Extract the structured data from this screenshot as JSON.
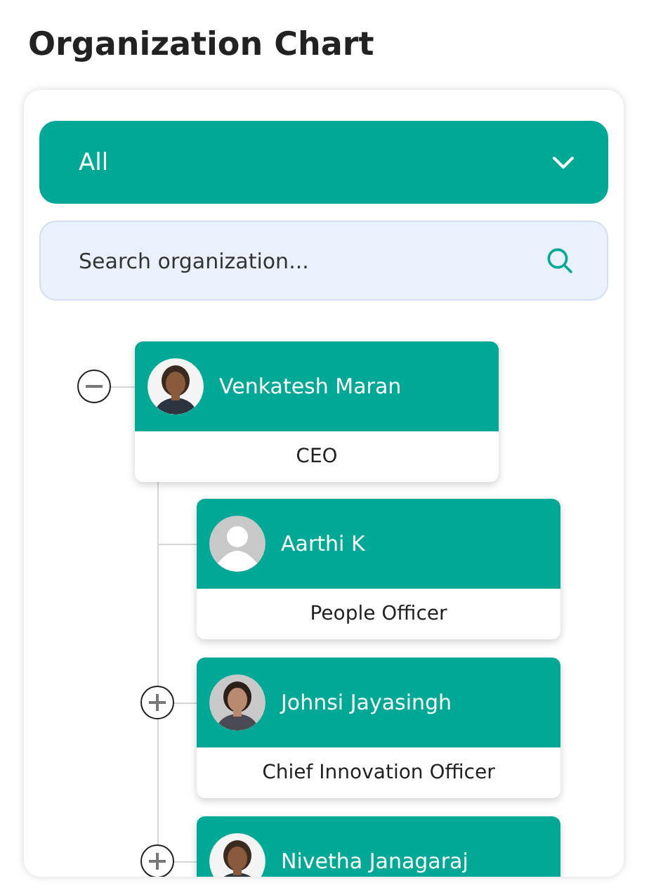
{
  "page": {
    "title": "Organization Chart"
  },
  "filter": {
    "value": "All"
  },
  "search": {
    "placeholder": "Search organization..."
  },
  "org_chart": {
    "nodes": [
      {
        "name": "Venkatesh Maran",
        "role": "CEO",
        "expanded": true,
        "children": [
          {
            "name": "Aarthi K",
            "role": "People Officer",
            "avatar": {
              "kind": "placeholder"
            }
          },
          {
            "name": "Johnsi Jayasingh",
            "role": "Chief Innovation Officer",
            "expanded": false
          },
          {
            "name": "Nivetha Janagaraj",
            "expanded": false
          }
        ]
      }
    ]
  }
}
